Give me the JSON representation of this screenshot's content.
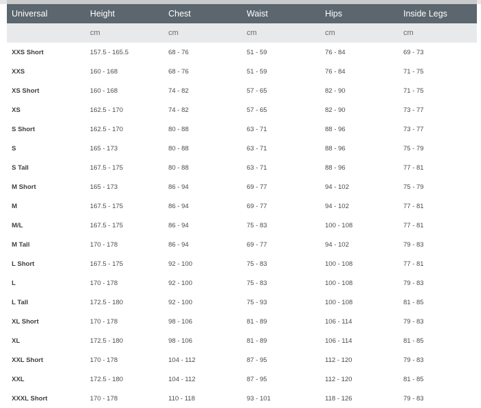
{
  "table": {
    "headers": [
      "Universal",
      "Height",
      "Chest",
      "Waist",
      "Hips",
      "Inside Legs"
    ],
    "units": [
      "",
      "cm",
      "cm",
      "cm",
      "cm",
      "cm"
    ],
    "rows": [
      [
        "XXS Short",
        "157.5 - 165.5",
        "68 - 76",
        "51 - 59",
        "76 - 84",
        "69 - 73"
      ],
      [
        "XXS",
        "160 - 168",
        "68 - 76",
        "51 - 59",
        "76 - 84",
        "71 - 75"
      ],
      [
        "XS Short",
        "160 - 168",
        "74 - 82",
        "57 - 65",
        "82 - 90",
        "71 - 75"
      ],
      [
        "XS",
        "162.5 - 170",
        "74 - 82",
        "57 - 65",
        "82 - 90",
        "73 - 77"
      ],
      [
        "S Short",
        "162.5 - 170",
        "80 - 88",
        "63 - 71",
        "88 - 96",
        "73 - 77"
      ],
      [
        "S",
        "165 - 173",
        "80 - 88",
        "63 - 71",
        "88 - 96",
        "75 - 79"
      ],
      [
        "S Tall",
        "167.5 - 175",
        "80 - 88",
        "63 - 71",
        "88 - 96",
        "77 - 81"
      ],
      [
        "M Short",
        "165 - 173",
        "86 - 94",
        "69 - 77",
        "94 - 102",
        "75 - 79"
      ],
      [
        "M",
        "167.5 - 175",
        "86 - 94",
        "69 - 77",
        "94 - 102",
        "77 - 81"
      ],
      [
        "M/L",
        "167.5 - 175",
        "86 - 94",
        "75 - 83",
        "100 - 108",
        "77 - 81"
      ],
      [
        "M Tall",
        "170 - 178",
        "86 - 94",
        "69 - 77",
        "94 - 102",
        "79 - 83"
      ],
      [
        "L Short",
        "167.5 - 175",
        "92 - 100",
        "75 - 83",
        "100 - 108",
        "77 - 81"
      ],
      [
        "L",
        "170 - 178",
        "92 - 100",
        "75 - 83",
        "100 - 108",
        "79 - 83"
      ],
      [
        "L Tall",
        "172.5 - 180",
        "92 - 100",
        "75 - 93",
        "100 - 108",
        "81 - 85"
      ],
      [
        "XL Short",
        "170 - 178",
        "98 - 106",
        "81 - 89",
        "106 - 114",
        "79 - 83"
      ],
      [
        "XL",
        "172.5 - 180",
        "98 - 106",
        "81 - 89",
        "106 - 114",
        "81 - 85"
      ],
      [
        "XXL Short",
        "170 - 178",
        "104 - 112",
        "87 - 95",
        "112 - 120",
        "79 - 83"
      ],
      [
        "XXL",
        "172.5 - 180",
        "104 - 112",
        "87 - 95",
        "112 - 120",
        "81 - 85"
      ],
      [
        "XXXL Short",
        "170 - 178",
        "110 - 118",
        "93 - 101",
        "118 - 126",
        "79 - 83"
      ]
    ]
  },
  "colors": {
    "header_bg": "#5b666e",
    "unit_row_bg": "#e8e9ea",
    "header_text": "#ffffff"
  }
}
